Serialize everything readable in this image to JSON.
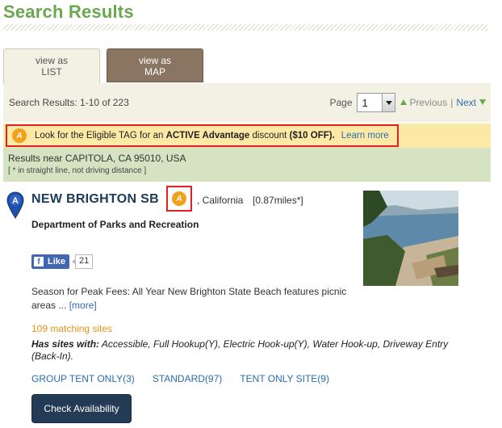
{
  "page": {
    "title": "Search Results"
  },
  "tabs": [
    {
      "label_line1": "view as",
      "label_line2": "LIST",
      "active": true
    },
    {
      "label_line1": "view as",
      "label_line2": "MAP",
      "active": false
    }
  ],
  "results_bar": {
    "count_text": "Search Results: 1-10 of 223",
    "page_label": "Page",
    "page_value": "1",
    "prev_label": "Previous",
    "separator": "|",
    "next_label": "Next"
  },
  "promo": {
    "icon_letter": "A",
    "text_before": "Look for the Eligible TAG for an ",
    "text_bold": "ACTIVE Advantage",
    "text_mid": " discount ",
    "text_offer": "($10 OFF).",
    "learn_more": "Learn more"
  },
  "near": {
    "title": "Results near CAPITOLA, CA 95010, USA",
    "note": "[ * in straight line, not driving distance ]"
  },
  "result": {
    "name": "NEW BRIGHTON SB",
    "tag_icon_letter": "A",
    "state": ", California",
    "distance": "[0.87miles*]",
    "agency": "Department of Parks and Recreation",
    "like_label": "Like",
    "like_count": "21",
    "description": "Season for Peak Fees: All Year New Brighton State Beach features picnic areas ...",
    "more_label": "[more]",
    "matching_sites": "109 matching sites",
    "has_sites_label": "Has sites with:",
    "has_sites_list": " Accessible, Full Hookup(Y), Electric Hook-up(Y), Water Hook-up, Driveway Entry (Back-In).",
    "site_links": [
      "GROUP TENT ONLY(3)",
      "STANDARD(97)",
      "TENT ONLY SITE(9)"
    ],
    "check_button": "Check Availability"
  },
  "colors": {
    "title_green": "#6aa84f",
    "promo_bg": "#fde9a6",
    "highlight_red": "#e32026",
    "near_bg": "#d5e3c2",
    "link_blue": "#2a6db0",
    "orange": "#e69418",
    "button_navy": "#243b56"
  },
  "icons": {
    "pin": "map-pin-icon",
    "tag": "active-advantage-tag-icon",
    "facebook": "facebook-icon",
    "dropdown": "chevron-down-icon"
  }
}
